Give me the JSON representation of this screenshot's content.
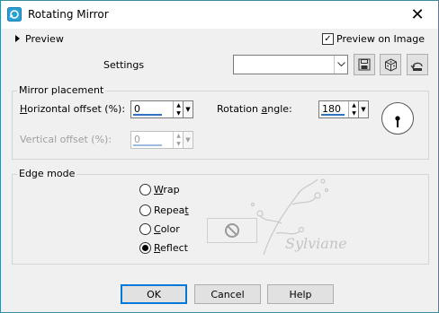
{
  "window": {
    "title": "Rotating Mirror",
    "close_glyph": "✕"
  },
  "preview": {
    "toggle_label": "Preview",
    "checkbox_label": "Preview on Image",
    "checkbox_checked": true
  },
  "settings": {
    "label": "Settings",
    "combo_value": ""
  },
  "mirror_placement": {
    "title": "Mirror placement",
    "horizontal": {
      "label": "Horizontal offset (%):",
      "value": "0"
    },
    "vertical": {
      "label": "Vertical offset (%):",
      "value": "0"
    },
    "rotation": {
      "label": "Rotation angle:",
      "value": "180"
    }
  },
  "edge_mode": {
    "title": "Edge mode",
    "options": {
      "wrap": "Wrap",
      "repeat": "Repeat",
      "color": "Color",
      "reflect": "Reflect"
    },
    "selected": "Reflect",
    "watermark_text": "Sylviane"
  },
  "buttons": {
    "ok": "OK",
    "cancel": "Cancel",
    "help": "Help"
  },
  "colors": {
    "accent": "#2f73c0",
    "titlebar_border": "#3a8aa0",
    "default_button": "#0078d7"
  }
}
